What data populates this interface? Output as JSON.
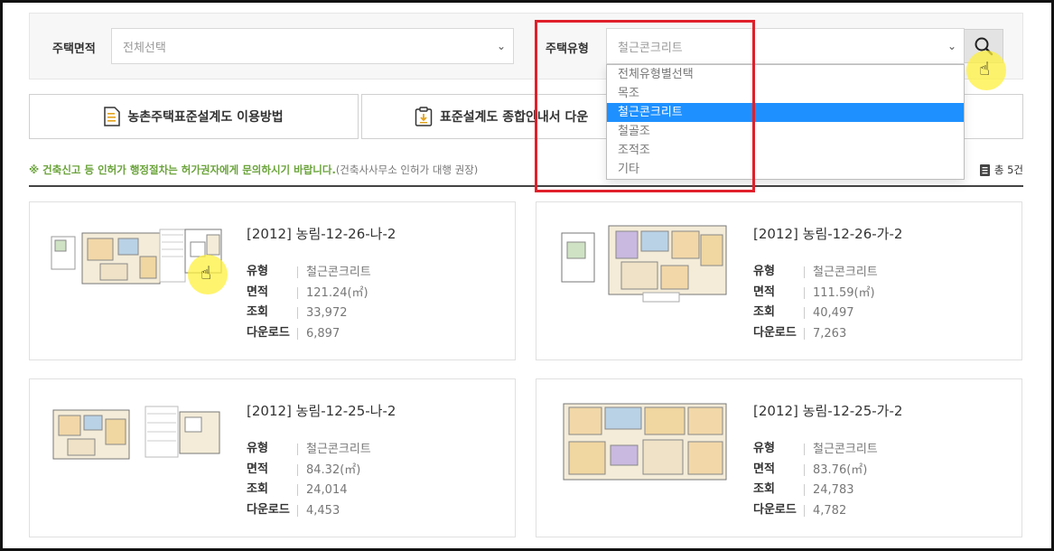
{
  "filters": {
    "area_label": "주택면적",
    "area_value": "전체선택",
    "type_label": "주택유형",
    "type_value": "철근콘크리트",
    "type_options": [
      "전체유형별선택",
      "목조",
      "철근콘크리트",
      "철골조",
      "조적조",
      "기타"
    ],
    "type_selected_index": 2,
    "search_icon": "search-icon"
  },
  "buttons": {
    "guide": "농촌주택표준설계도 이용방법",
    "download": "표준설계도 종합안내서 다운"
  },
  "notice": {
    "main": "※ 건축신고 등 인허가 행정절차는 허가권자에게 문의하시기 바랍니다.",
    "sub": "(건축사사무소 인허가 대행 권장)"
  },
  "total": "총 5건",
  "meta_labels": {
    "type": "유형",
    "area": "면적",
    "views": "조회",
    "downloads": "다운로드"
  },
  "cards": [
    {
      "title": "[2012] 농림-12-26-나-2",
      "type": "철근콘크리트",
      "area": "121.24(㎡)",
      "views": "33,972",
      "downloads": "6,897"
    },
    {
      "title": "[2012] 농림-12-26-가-2",
      "type": "철근콘크리트",
      "area": "111.59(㎡)",
      "views": "40,497",
      "downloads": "7,263"
    },
    {
      "title": "[2012] 농림-12-25-나-2",
      "type": "철근콘크리트",
      "area": "84.32(㎡)",
      "views": "24,014",
      "downloads": "4,453"
    },
    {
      "title": "[2012] 농림-12-25-가-2",
      "type": "철근콘크리트",
      "area": "83.76(㎡)",
      "views": "24,783",
      "downloads": "4,782"
    }
  ],
  "colors": {
    "accent_green": "#6aa33a",
    "selected_blue": "#1e90ff",
    "highlight_red": "#e0202a"
  }
}
